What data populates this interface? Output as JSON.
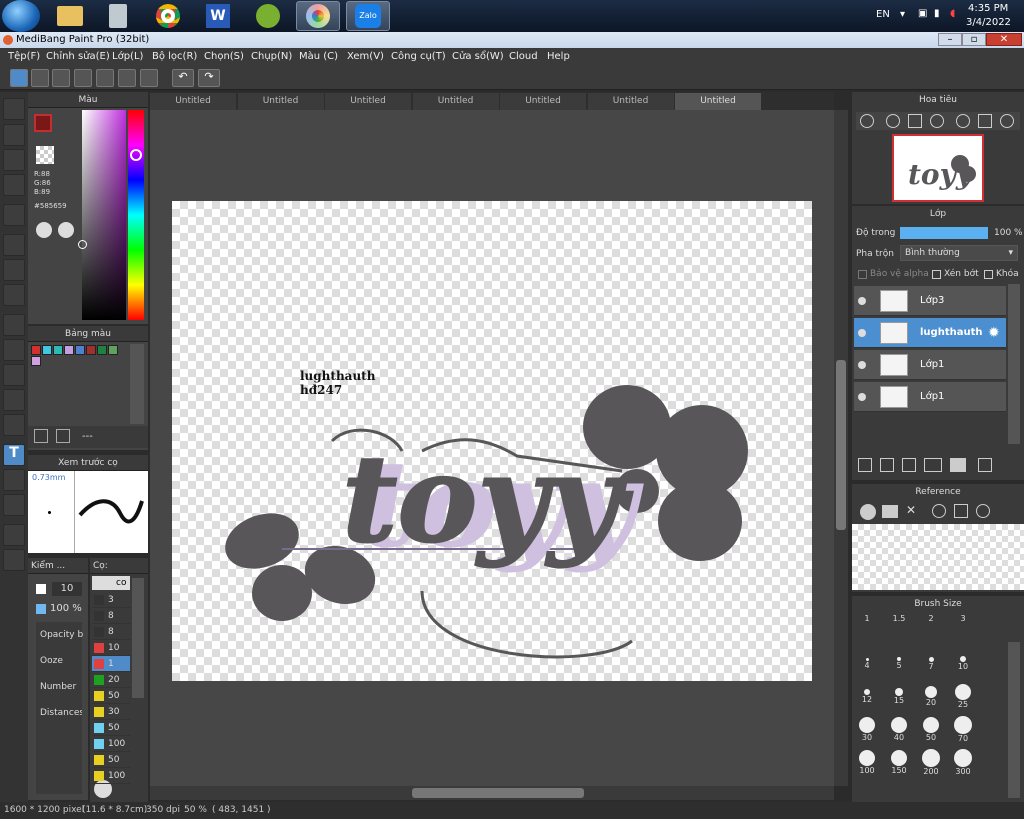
{
  "taskbar": {
    "lang": "EN",
    "time": "4:35 PM",
    "date": "3/4/2022",
    "zalo_label": "Zalo"
  },
  "window": {
    "title": "MediBang Paint Pro (32bit)"
  },
  "menu": [
    "Tệp(F)",
    "Chỉnh sửa(E)",
    "Lớp(L)",
    "Bộ lọc(R)",
    "Chọn(S)",
    "Chụp(N)",
    "Màu (C)",
    "Xem(V)",
    "Công cụ(T)",
    "Cửa sổ(W)",
    "Cloud",
    "Help"
  ],
  "color_panel": {
    "title": "Màu",
    "r": "R:88",
    "g": "G:86",
    "b": "B:89",
    "hex": "#585659"
  },
  "palette_panel": {
    "title": "Bảng màu",
    "swatches": [
      "#d03030",
      "#40c8e0",
      "#30b8b0",
      "#c0a0e0",
      "#5080d0",
      "#a03030",
      "#208040",
      "#60a060",
      "#d0a0e0"
    ],
    "dash": "---"
  },
  "preview_panel": {
    "title": "Xem trước cọ",
    "size": "0.73mm"
  },
  "size_panel": {
    "title": "Kiểm ...",
    "size_value": "10",
    "opacity_value": "100 %",
    "props": [
      "Opacity b",
      "Ooze",
      "Number",
      "Distances"
    ]
  },
  "brush_panel": {
    "title": "Cọ:",
    "header": "co",
    "rows": [
      {
        "c": "#333",
        "v": "3"
      },
      {
        "c": "#333",
        "v": "8"
      },
      {
        "c": "#333",
        "v": "8"
      },
      {
        "c": "#e04040",
        "v": "10"
      },
      {
        "c": "#e04040",
        "v": "1"
      },
      {
        "c": "#20a020",
        "v": "20"
      },
      {
        "c": "#e8d020",
        "v": "50"
      },
      {
        "c": "#e8d020",
        "v": "30"
      },
      {
        "c": "#70d0f0",
        "v": "50"
      },
      {
        "c": "#70d0f0",
        "v": "100"
      },
      {
        "c": "#e8d020",
        "v": "50"
      },
      {
        "c": "#e8d020",
        "v": "100"
      }
    ]
  },
  "tabs": [
    "Untitled",
    "Untitled",
    "Untitled",
    "Untitled",
    "Untitled",
    "Untitled",
    "Untitled"
  ],
  "canvas": {
    "text_line1": "lughthauth",
    "text_line2": "hđ247",
    "art_word": "toyy"
  },
  "navigator": {
    "title": "Hoa tiêu"
  },
  "layer_panel": {
    "title": "Lớp",
    "opacity_label": "Độ trong",
    "opacity_value": "100 %",
    "blend_label": "Pha trộn",
    "blend_value": "Bình thường",
    "protect_alpha": "Bảo vệ alpha",
    "clip": "Xén bớt",
    "lock": "Khóa",
    "layers": [
      {
        "name": "Lớp3",
        "selected": false
      },
      {
        "name": "lughthauth",
        "selected": true
      },
      {
        "name": "Lớp1",
        "selected": false
      },
      {
        "name": "Lớp1",
        "selected": false
      }
    ]
  },
  "reference_panel": {
    "title": "Reference"
  },
  "brush_size_panel": {
    "title": "Brush Size",
    "sizes": [
      "1",
      "1.5",
      "2",
      "3",
      "4",
      "5",
      "7",
      "10",
      "12",
      "15",
      "20",
      "25",
      "30",
      "40",
      "50",
      "70",
      "100",
      "150",
      "200",
      "300"
    ]
  },
  "status": {
    "pixels": "1600 * 1200 pixel",
    "cm": "(11.6 * 8.7cm)",
    "dpi": "350 dpi",
    "zoom": "50 %",
    "coords": "( 483, 1451 )"
  }
}
